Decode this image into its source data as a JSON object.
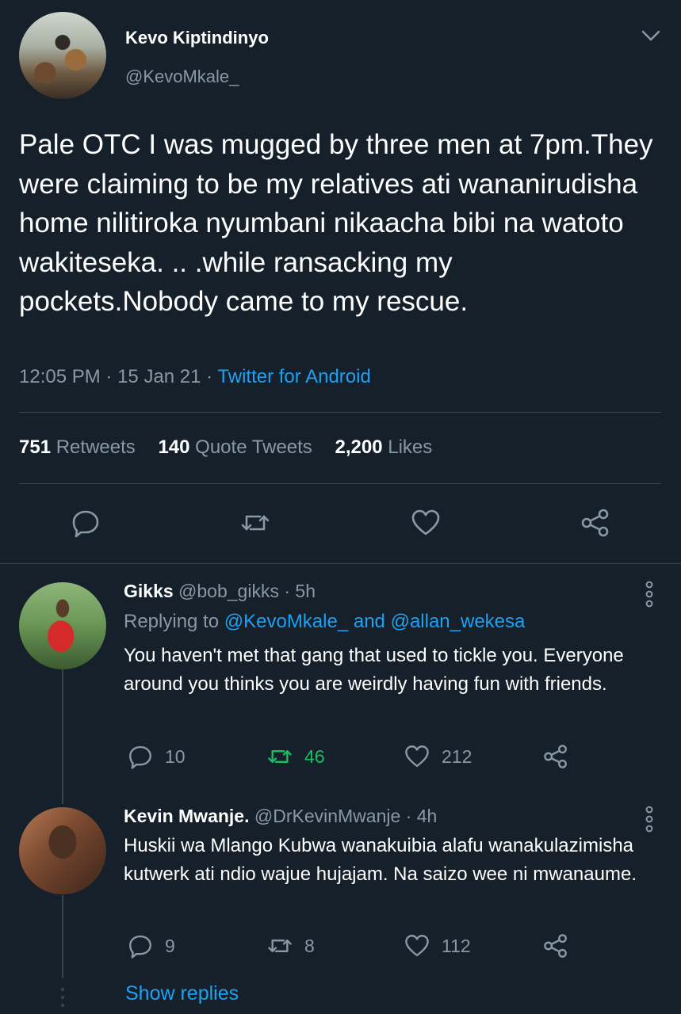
{
  "tweet": {
    "author_name": "Kevo Kiptindinyo",
    "author_handle": "@KevoMkale_",
    "text": "Pale OTC I was mugged by three men at 7pm.They were claiming to be my relatives ati wananirudisha home nilitiroka nyumbani nikaacha bibi na watoto wakiteseka. .. .while ransacking my pockets.Nobody came to my rescue.",
    "time": "12:05 PM",
    "date": "15 Jan 21",
    "separator": "·",
    "source": "Twitter for Android",
    "stats": {
      "retweets_count": "751",
      "retweets_label": "Retweets",
      "quotes_count": "140",
      "quotes_label": "Quote Tweets",
      "likes_count": "2,200",
      "likes_label": "Likes"
    }
  },
  "replies": [
    {
      "name": "Gikks",
      "handle": "@bob_gikks",
      "time": "5h",
      "replying_prefix": "Replying to",
      "replying_user1": "@KevoMkale_",
      "replying_and": "and",
      "replying_user2": "@allan_wekesa",
      "text": "You haven't met that gang that used to tickle you. Everyone around you thinks you are weirdly having fun with friends.",
      "reply_count": "10",
      "retweet_count": "46",
      "like_count": "212"
    },
    {
      "name": "Kevin Mwanje.",
      "handle": "@DrKevinMwanje",
      "time": "4h",
      "text": "Huskii wa Mlango Kubwa wanakuibia alafu wanakulazimisha kutwerk ati ndio wajue hujajam. Na saizo wee ni mwanaume.",
      "reply_count": "9",
      "retweet_count": "8",
      "like_count": "112"
    }
  ],
  "show_replies": "Show replies",
  "colors": {
    "background": "#15202b",
    "text_primary": "#ffffff",
    "text_secondary": "#8899a6",
    "accent": "#1da1f2",
    "retweet_active": "#17bf63",
    "divider": "#38444d"
  },
  "icons": [
    "chevron-down-icon",
    "reply-icon",
    "retweet-icon",
    "like-icon",
    "share-icon",
    "more-icon"
  ]
}
